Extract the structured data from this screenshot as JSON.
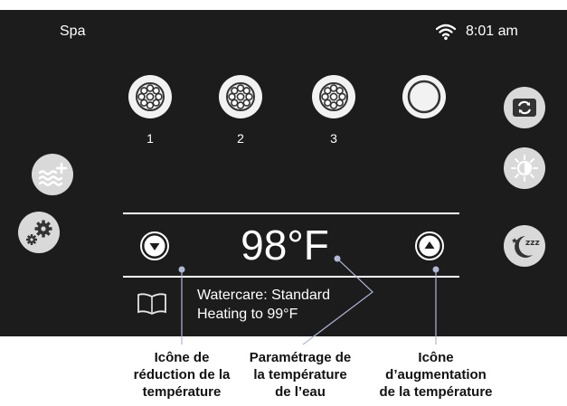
{
  "header": {
    "title": "Spa",
    "time": "8:01 am",
    "wifi_icon": "wifi-icon"
  },
  "jets": [
    {
      "label": "1",
      "icon": "jet-icon"
    },
    {
      "label": "2",
      "icon": "jet-icon"
    },
    {
      "label": "3",
      "icon": "jet-icon"
    },
    {
      "label": "",
      "icon": "light-ring-icon"
    }
  ],
  "left_buttons": [
    "water-add-icon",
    "settings-gears-icon"
  ],
  "right_buttons": [
    "refresh-icon",
    "brightness-icon",
    "sleep-icon"
  ],
  "temperature": {
    "value": "98°F"
  },
  "status": {
    "line1": "Watercare: Standard",
    "line2": "Heating to 99°F",
    "icon": "book-icon"
  },
  "captions": {
    "decrease": [
      "Icône de",
      "réduction de la",
      "température"
    ],
    "setting": [
      "Paramétrage de",
      "la température",
      "de l’eau"
    ],
    "increase": [
      "Icône",
      "d’augmentation",
      "de la température"
    ]
  },
  "colors": {
    "screen_bg": "#1c1c1c",
    "button_bg": "#d9d9d9",
    "icon_dark": "#333333",
    "callout_line": "#b0b8d8"
  }
}
